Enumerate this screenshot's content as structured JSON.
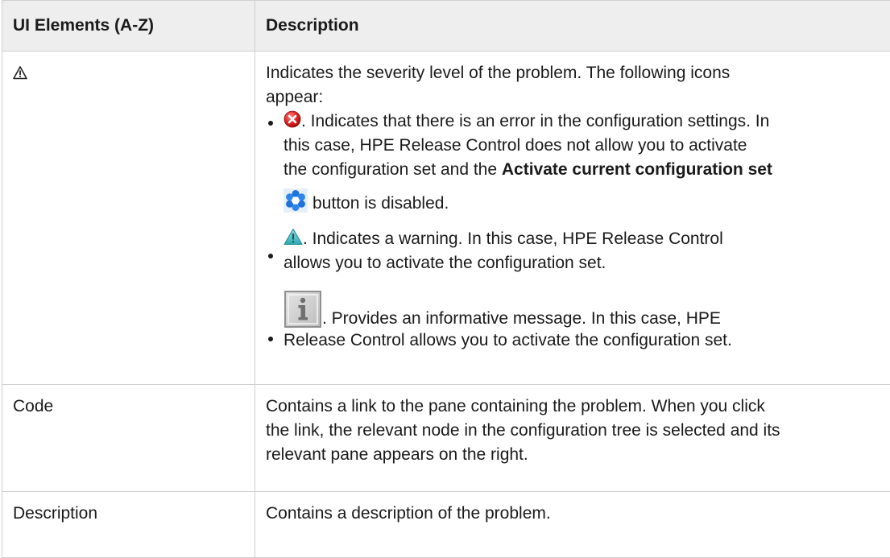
{
  "table": {
    "header": {
      "col1": "UI Elements (A-Z)",
      "col2": "Description"
    },
    "rows": [
      {
        "element_icon": "warning-triangle-icon",
        "description_intro_1": "Indicates the severity level of the problem. The following icons",
        "description_intro_2": "appear:",
        "bullets": [
          {
            "icon": "error-icon",
            "line1": ". Indicates that there is an error in the configuration settings. In",
            "line2": "this case, HPE Release Control does not allow you to activate",
            "line3_pre": "the configuration set and the ",
            "line3_bold": "Activate current configuration set",
            "line4_icon": "activate-gear-icon",
            "line4": "button is disabled."
          },
          {
            "icon": "warning-icon",
            "line1": ". Indicates a warning. In this case, HPE Release Control",
            "line2": "allows you to activate the configuration set."
          },
          {
            "icon": "info-icon",
            "line1": ". Provides an informative message. In this case, HPE",
            "line2": "Release Control allows you to activate the configuration set."
          }
        ]
      },
      {
        "element": "Code",
        "line1": "Contains a link to the pane containing the problem. When you click",
        "line2": "the link, the relevant node in the configuration tree is selected and its",
        "line3": "relevant pane appears on the right."
      },
      {
        "element": "Description",
        "line1": "Contains a description of the problem."
      }
    ]
  }
}
